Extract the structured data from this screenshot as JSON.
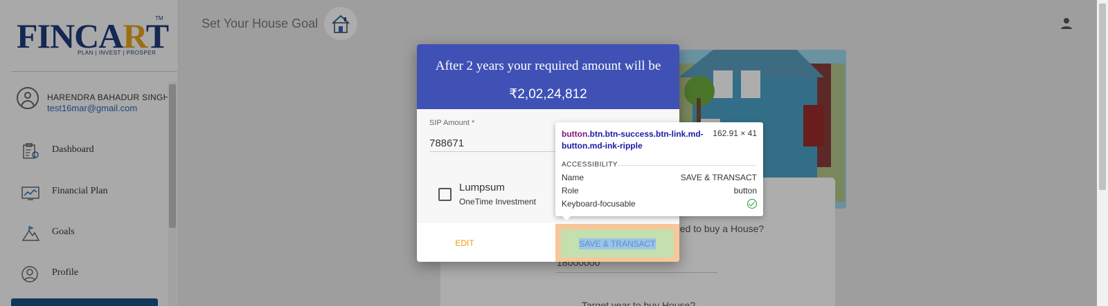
{
  "app": {
    "logo_text": "FINCART",
    "logo_tagline": "PLAN | INVEST | PROSPER",
    "logo_tm": "TM",
    "page_title": "Set Your House Goal"
  },
  "user": {
    "name": "HARENDRA BAHADUR SINGH",
    "email": "test16mar@gmail.com"
  },
  "sidebar": {
    "items": [
      {
        "label": "Dashboard",
        "icon": "dashboard-icon"
      },
      {
        "label": "Financial Plan",
        "icon": "chart-icon"
      },
      {
        "label": "Goals",
        "icon": "mountain-flag-icon"
      },
      {
        "label": "Profile",
        "icon": "profile-icon"
      }
    ]
  },
  "background_form": {
    "question_1": "eed to buy a House?",
    "value_1": "18000000",
    "question_2": "Target year to buy House?"
  },
  "dialog": {
    "title": "After 2 years your required amount will be",
    "amount": "₹2,02,24,812",
    "sip_label": "SIP Amount *",
    "sip_value": "788671",
    "lumpsum_label": "Lumpsum",
    "lumpsum_sub": "OneTime Investment",
    "lumpsum_checked": false,
    "edit_label": "EDIT",
    "save_label": "SAVE & TRANSACT",
    "header_color": "#3f51b5"
  },
  "tooltip": {
    "selector_tag": "button",
    "selector_classes": ".btn.btn-success.btn-link.md-button.md-ink-ripple",
    "dimensions": "162.91 × 41",
    "section": "ACCESSIBILITY",
    "rows": [
      {
        "key": "Name",
        "value": "SAVE & TRANSACT"
      },
      {
        "key": "Role",
        "value": "button"
      },
      {
        "key": "Keyboard-focusable",
        "value": ""
      }
    ]
  }
}
